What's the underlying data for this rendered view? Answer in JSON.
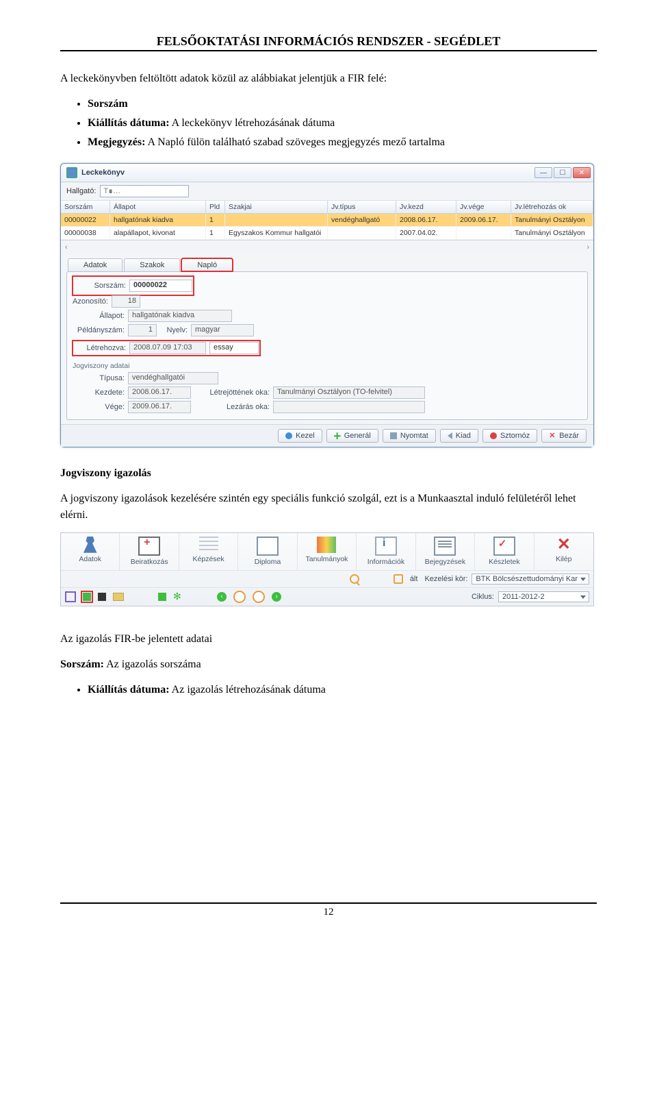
{
  "header": "FELSŐOKTATÁSI INFORMÁCIÓS RENDSZER -  SEGÉDLET",
  "intro": "A leckekönyvben feltöltött adatok közül az alábbiakat jelentjük a FIR felé:",
  "bullets1": [
    {
      "b": "Sorszám"
    },
    {
      "b": "Kiállítás dátuma:",
      "t": " A leckekönyv létrehozásának dátuma"
    },
    {
      "b": "Megjegyzés:",
      "t": " A Napló fülön található szabad szöveges megjegyzés mező tartalma"
    }
  ],
  "win": {
    "title": "Leckekönyv",
    "hallgato_label": "Hallgató:",
    "hallgato_value": "T∎…",
    "cols": [
      "Sorszám",
      "Állapot",
      "Pld",
      "Szakjai",
      "Jv.típus",
      "Jv.kezd",
      "Jv.vége",
      "Jv.létrehozás ok"
    ],
    "rows": [
      {
        "sor": "00000022",
        "all": "hallgatónak kiadva",
        "pld": "1",
        "szak": "",
        "tip": "vendéghallgató",
        "kezd": "2008.06.17.",
        "vege": "2009.06.17.",
        "ok": "Tanulmányi Osztályon"
      },
      {
        "sor": "00000038",
        "all": "alapállapot, kivonat",
        "pld": "1",
        "szak": "Egyszakos Kommur hallgatói",
        "tip": "",
        "kezd": "2007.04.02.",
        "vege": "",
        "ok": "Tanulmányi Osztályon"
      }
    ],
    "tabs": [
      "Adatok",
      "Szakok",
      "Napló"
    ],
    "form": {
      "sorszam_label": "Sorszám:",
      "sorszam": "00000022",
      "azon_label": "Azonosító:",
      "azon": "18",
      "allapot_label": "Állapot:",
      "allapot": "hallgatónak kiadva",
      "pld_label": "Példányszám:",
      "pld": "1",
      "nyelv_label": "Nyelv:",
      "nyelv": "magyar",
      "letre_label": "Létrehozva:",
      "letre": "2008.07.09 17:03",
      "essay": "essay",
      "group": "Jogviszony adatai",
      "tip_label": "Típusa:",
      "tip": "vendéghallgatói",
      "kezd_label": "Kezdete:",
      "kezd": "2008.06.17.",
      "lok_label": "Létrejöttének oka:",
      "lok": "Tanulmányi Osztályon (TO-felvitel)",
      "vege_label": "Vége:",
      "vege": "2009.06.17.",
      "lez_label": "Lezárás oka:"
    },
    "buttons": {
      "kezel": "Kezel",
      "general": "Generál",
      "nyomtat": "Nyomtat",
      "kiad": "Kiad",
      "sztornoz": "Sztornóz",
      "bezar": "Bezár"
    }
  },
  "heading2": "Jogviszony igazolás",
  "para2": "A jogviszony igazolások kezelésére szintén egy speciális funkció szolgál, ezt is a Munkaasztal induló felületéről lehet elérni.",
  "tb2": {
    "items": [
      "Adatok",
      "Beiratkozás",
      "Képzések",
      "Diploma",
      "Tanulmányok",
      "Információk",
      "Bejegyzések",
      "Készletek",
      "Kilép"
    ],
    "alt": "ált",
    "kezkor_label": "Kezelési kör:",
    "kezkor": "BTK Bölcsészettudományi Kar",
    "ciklus_label": "Ciklus:",
    "ciklus": "2011-2012-2"
  },
  "heading3": "Az igazolás FIR-be jelentett adatai",
  "sorszam_line_b": "Sorszám:",
  "sorszam_line_t": " Az igazolás sorszáma",
  "bullets3": [
    {
      "b": "Kiállítás dátuma:",
      "t": " Az igazolás létrehozásának dátuma"
    }
  ],
  "page_num": "12"
}
